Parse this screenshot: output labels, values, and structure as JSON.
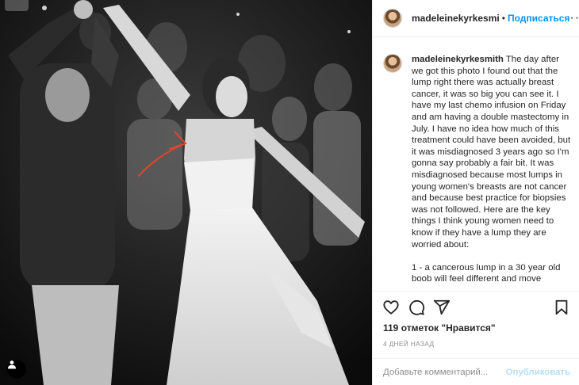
{
  "post": {
    "username": "madeleinekyrkesmi",
    "follow_label": "Подписаться",
    "separator": "•",
    "more_label": "···",
    "caption_user": "madeleinekyrkesmith",
    "caption_text": " The day after we got this photo I found out that the lump right there was actually breast cancer, it was so big you can see it. I have my last chemo infusion on Friday and am having a double mastectomy in July. I have no idea how much of this treatment could have been avoided, but it was misdiagnosed 3 years ago so I'm gonna say probably a fair bit. It was misdiagnosed because most lumps in young women's breasts are not cancer and because best practice for biopsies was not followed. Here are the key things I think young women need to know if they have a lump they are worried about:\n\n1 - a cancerous lump in a 30 year old boob will feel different and move",
    "likes": "119 отметок \"Нравится\"",
    "date": "4 ДНЕЙ НАЗАД",
    "comment_placeholder": "Добавьте комментарий...",
    "publish_label": "Опубликовать"
  },
  "icons": {
    "like": "heart-icon",
    "comment": "comment-icon",
    "share": "paper-plane-icon",
    "save": "bookmark-icon",
    "tag": "user-tag-icon"
  },
  "colors": {
    "accent": "#0095f6",
    "publish_disabled": "#b2dffc",
    "annotation_arrow": "#e0452a"
  }
}
